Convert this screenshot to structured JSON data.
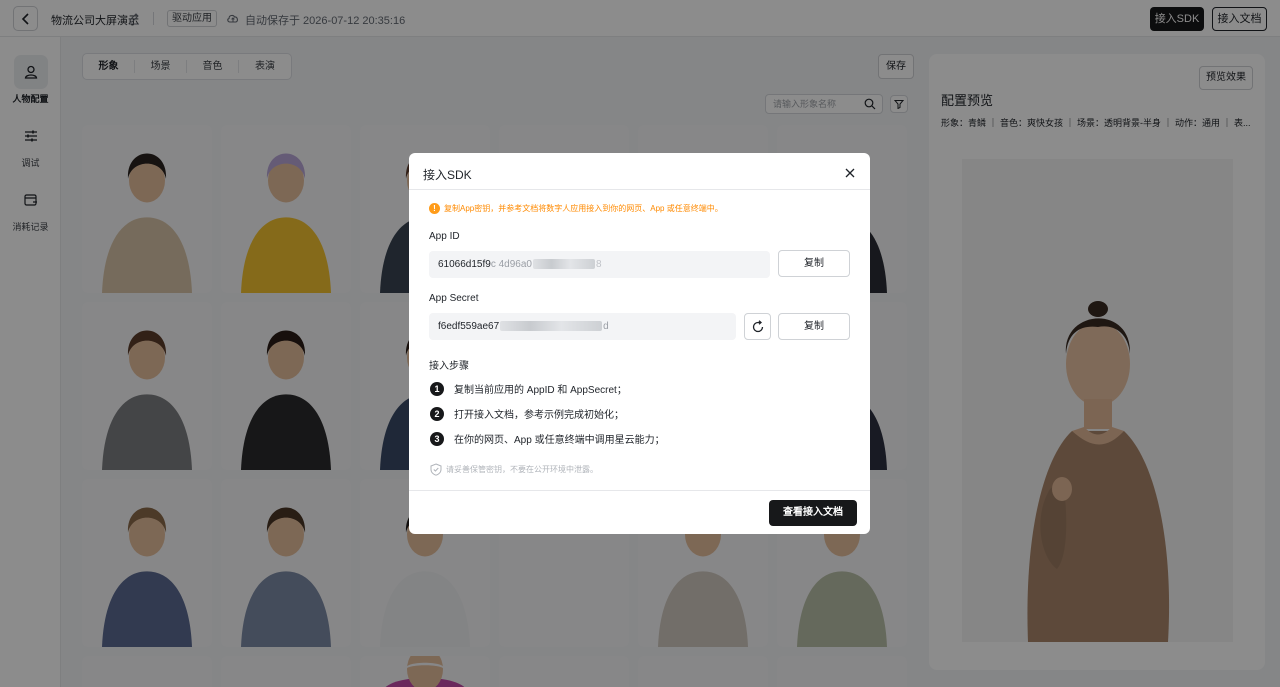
{
  "topbar": {
    "app_name": "物流公司大屏演示",
    "tag": "驱动应用",
    "autosave": "自动保存于 2026-07-12 20:35:16",
    "btn_sdk": "接入SDK",
    "btn_docs": "接入文档"
  },
  "leftnav": {
    "items": [
      {
        "label": "人物配置",
        "icon": "person-icon",
        "active": true
      },
      {
        "label": "调试",
        "icon": "sliders-icon",
        "active": false
      },
      {
        "label": "消耗记录",
        "icon": "receipt-icon",
        "active": false
      }
    ]
  },
  "main": {
    "tabs": [
      "形象",
      "场景",
      "音色",
      "表演"
    ],
    "active_tab": "形象",
    "save_label": "保存",
    "search_placeholder": "请输入形象名称"
  },
  "preview": {
    "btn_label": "预览效果",
    "title": "配置预览",
    "meta": "形象：青鳞 ｜ 音色：爽快女孩 ｜ 场景：透明背景-半身 ｜ 动作：通用 ｜ 表..."
  },
  "modal": {
    "title": "接入SDK",
    "warning": "复制App密钥，并参考文档将数字人应用接入到你的网页、App 或任意终端中。",
    "app_id_label": "App ID",
    "app_id_prefix": "61066d15f9",
    "app_id_mid": "c 4d96a0",
    "app_id_suffix": "8",
    "app_secret_label": "App Secret",
    "app_secret_prefix": "f6edf559ae67",
    "app_secret_suffix": "d",
    "copy_label": "复制",
    "steps_title": "接入步骤",
    "steps": [
      "复制当前应用的 AppID 和 AppSecret；",
      "打开接入文档，参考示例完成初始化；",
      "在你的网页、App 或任意终端中调用星云能力；"
    ],
    "note": "请妥善保管密钥，不要在公开环境中泄露。",
    "view_docs_label": "查看接入文档"
  },
  "colors": {
    "primary_dark": "#17181a",
    "warning": "#ff8a00",
    "overlay": "rgba(0,0,0,0.45)"
  }
}
